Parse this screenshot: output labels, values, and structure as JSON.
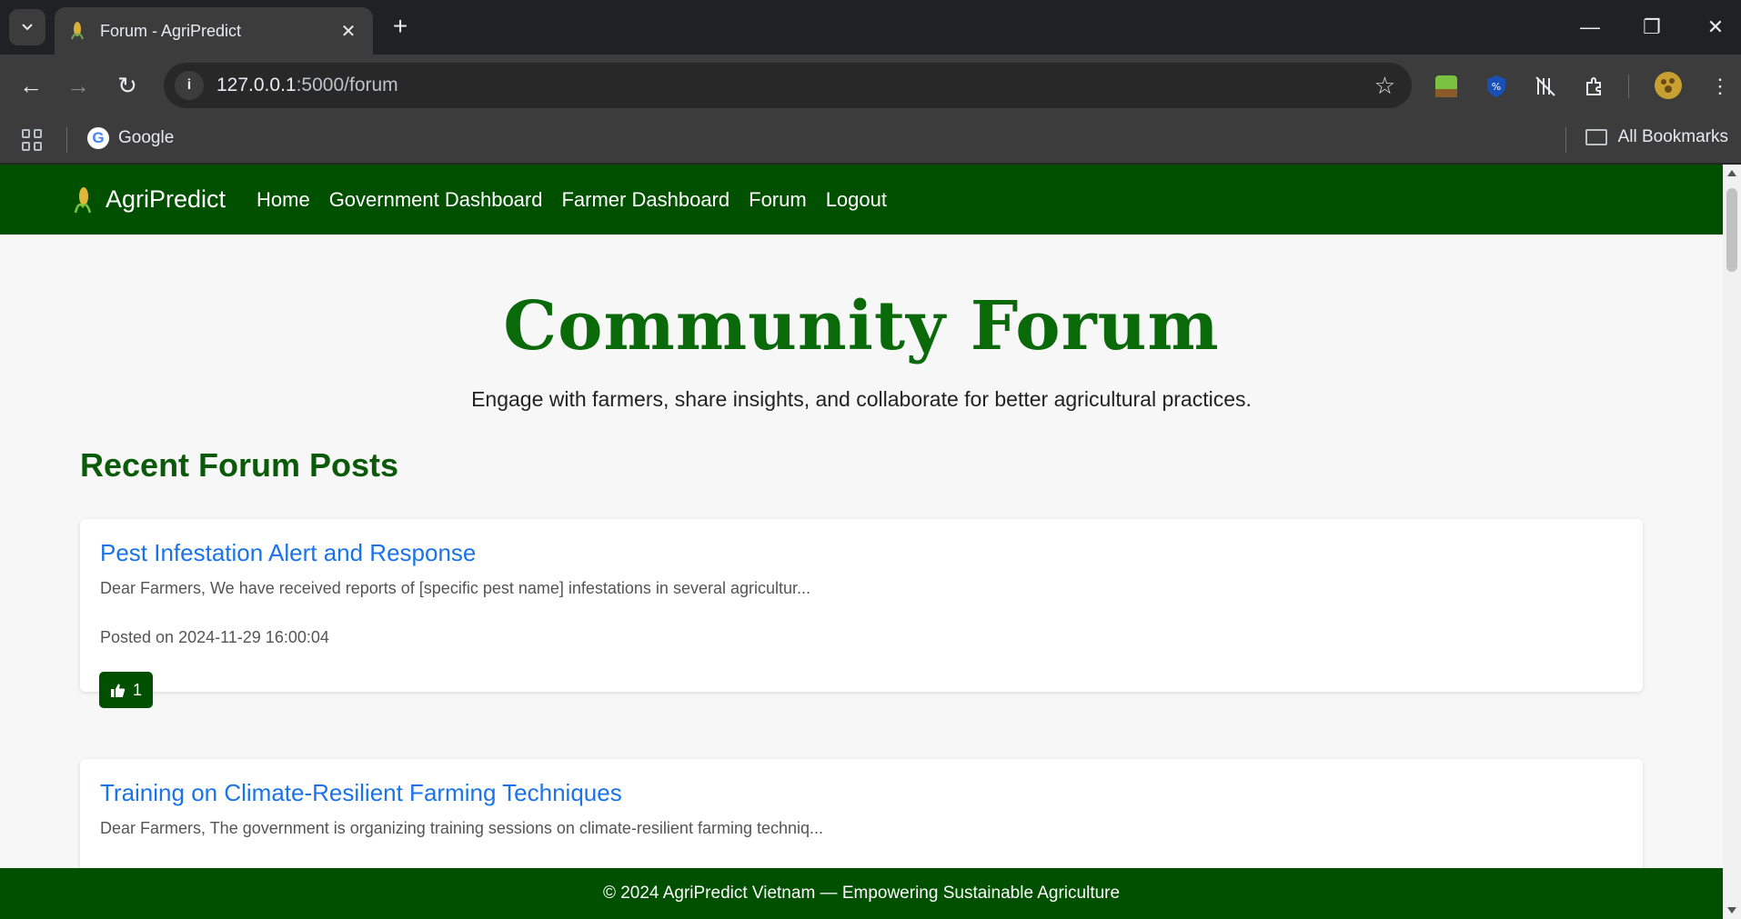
{
  "browser": {
    "tab_title": "Forum - AgriPredict",
    "url_host": "127.0.0.1",
    "url_path": ":5000/forum",
    "bookmarks": {
      "google": "Google",
      "all_bookmarks": "All Bookmarks"
    }
  },
  "site": {
    "brand": "AgriPredict",
    "nav": [
      "Home",
      "Government Dashboard",
      "Farmer Dashboard",
      "Forum",
      "Logout"
    ]
  },
  "hero": {
    "title": "Community Forum",
    "subtitle": "Engage with farmers, share insights, and collaborate for better agricultural practices."
  },
  "section_title": "Recent Forum Posts",
  "posts": [
    {
      "title": "Pest Infestation Alert and Response",
      "excerpt": "Dear Farmers, We have received reports of [specific pest name] infestations in several agricultur...",
      "date": "Posted on 2024-11-29 16:00:04",
      "likes": "1"
    },
    {
      "title": "Training on Climate-Resilient Farming Techniques",
      "excerpt": "Dear Farmers, The government is organizing training sessions on climate-resilient farming techniq..."
    }
  ],
  "footer": "© 2024 AgriPredict Vietnam — Empowering Sustainable Agriculture",
  "colors": {
    "primary_green": "#005000",
    "link_blue": "#1a73e8",
    "title_green": "#0a6a0a"
  }
}
